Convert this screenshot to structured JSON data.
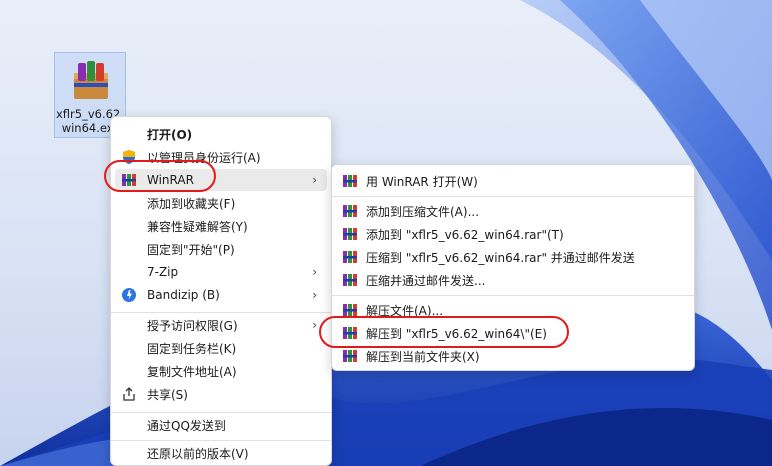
{
  "desktop": {
    "file_name": "xflr5_v6.62_win64.exe",
    "file_icon": "winrar-archive-icon"
  },
  "context_menu": {
    "items": [
      {
        "label": "打开(O)",
        "icon": "",
        "bold": true
      },
      {
        "label": "以管理员身份运行(A)",
        "icon": "uac-shield-icon"
      },
      {
        "label": "WinRAR",
        "icon": "winrar-icon",
        "submenu": true
      },
      {
        "label": "添加到收藏夹(F)",
        "icon": ""
      },
      {
        "label": "兼容性疑难解答(Y)",
        "icon": ""
      },
      {
        "label": "固定到\"开始\"(P)",
        "icon": ""
      },
      {
        "label": "7-Zip",
        "icon": "",
        "submenu": true
      },
      {
        "label": "Bandizip (B)",
        "icon": "bandizip-icon",
        "submenu": true
      },
      {
        "label": "授予访问权限(G)",
        "icon": "",
        "submenu": true
      },
      {
        "label": "固定到任务栏(K)",
        "icon": ""
      },
      {
        "label": "复制文件地址(A)",
        "icon": ""
      },
      {
        "label": "共享(S)",
        "icon": "share-icon"
      },
      {
        "label": "通过QQ发送到",
        "icon": ""
      },
      {
        "label": "还原以前的版本(V)",
        "icon": ""
      }
    ]
  },
  "winrar_submenu": {
    "items": [
      {
        "label": "用 WinRAR 打开(W)",
        "icon": "winrar-icon"
      },
      {
        "label": "添加到压缩文件(A)...",
        "icon": "winrar-icon"
      },
      {
        "label": "添加到 \"xflr5_v6.62_win64.rar\"(T)",
        "icon": "winrar-icon"
      },
      {
        "label": "压缩到 \"xflr5_v6.62_win64.rar\" 并通过邮件发送",
        "icon": "winrar-icon"
      },
      {
        "label": "压缩并通过邮件发送...",
        "icon": "winrar-icon"
      },
      {
        "label": "解压文件(A)...",
        "icon": "winrar-icon"
      },
      {
        "label": "解压到 \"xflr5_v6.62_win64\\\"(E)",
        "icon": "winrar-icon"
      },
      {
        "label": "解压到当前文件夹(X)",
        "icon": "winrar-icon"
      }
    ]
  },
  "colors": {
    "highlight_ring": "#e31a1a",
    "menu_hover": "#eaeaea",
    "wallpaper_blue": "#2f5fd6"
  }
}
